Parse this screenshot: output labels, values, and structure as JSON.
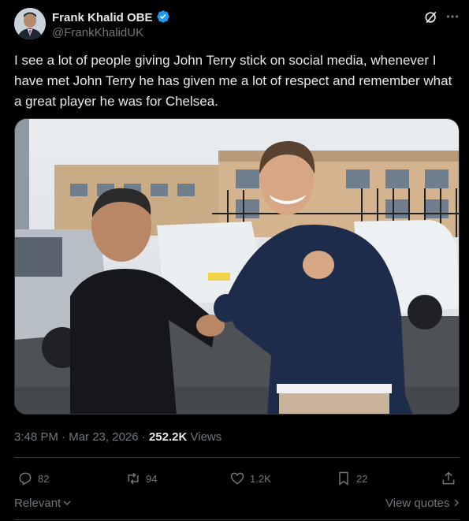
{
  "author": {
    "name": "Frank Khalid OBE",
    "handle": "@FrankKhalidUK"
  },
  "post": {
    "text": "I see a lot of people giving John Terry stick on social media, whenever I have met John Terry he has given me a lot of respect and remember what a great player he was for Chelsea.",
    "time": "3:48 PM",
    "date": "Mar 23, 2026",
    "separator1": "·",
    "separator2": "·",
    "views_count": "252.2K",
    "views_label": "Views"
  },
  "stats": {
    "replies": "82",
    "reposts": "94",
    "likes": "1.2K",
    "bookmarks": "22"
  },
  "footer": {
    "relevant_label": "Relevant",
    "view_quotes_label": "View quotes"
  },
  "colors": {
    "background": "#000000",
    "text_primary": "#e7e9ea",
    "text_secondary": "#71767b",
    "verified_blue": "#1d9bf0",
    "divider": "#2f3336"
  }
}
